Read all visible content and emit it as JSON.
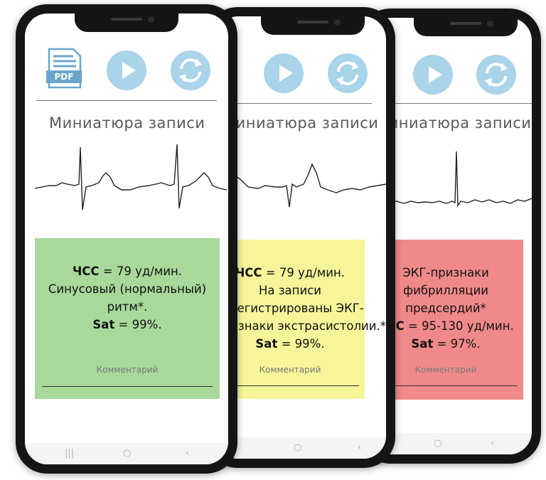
{
  "colors": {
    "phone_body": "#151515",
    "button_fill": "#a9d4ea",
    "pdf_icon": "#6aa6cc",
    "normal_card": "#a8d99b",
    "warning_card": "#f7f59a",
    "alert_card": "#f08a8a"
  },
  "icons": {
    "pdf": "pdf-document-icon",
    "play": "play-icon",
    "refresh": "refresh-icon"
  },
  "common": {
    "pdf_label": "PDF",
    "thumbnail_title": "Миниатюра записи",
    "comment_label": "Комментарий"
  },
  "phones": [
    {
      "status": "normal",
      "result_lines": [
        {
          "bold": "ЧСС",
          "text": " = 79 уд/мин."
        },
        {
          "bold": "",
          "text": "Синусовый (нормальный)"
        },
        {
          "bold": "",
          "text": "ритм*."
        },
        {
          "bold": "Sat",
          "text": " = 99%."
        }
      ]
    },
    {
      "status": "warning",
      "result_lines": [
        {
          "bold": "ЧСС",
          "text": " = 79 уд/мин."
        },
        {
          "bold": "",
          "text": "На записи"
        },
        {
          "bold": "",
          "text": "зарегистрированы ЭКГ-"
        },
        {
          "bold": "",
          "text": "признаки экстрасистолии.*"
        },
        {
          "bold": "Sat",
          "text": " = 99%."
        }
      ]
    },
    {
      "status": "alert",
      "result_lines": [
        {
          "bold": "",
          "text": "ЭКГ-признаки"
        },
        {
          "bold": "",
          "text": "фибрилляции"
        },
        {
          "bold": "",
          "text": "предсердий*"
        },
        {
          "bold": "ЧСС",
          "text": " = 95-130 уд/мин."
        },
        {
          "bold": "Sat",
          "text": " = 97%."
        }
      ]
    }
  ],
  "navigation": {
    "recents": "|||",
    "home": "○",
    "back": "‹"
  }
}
